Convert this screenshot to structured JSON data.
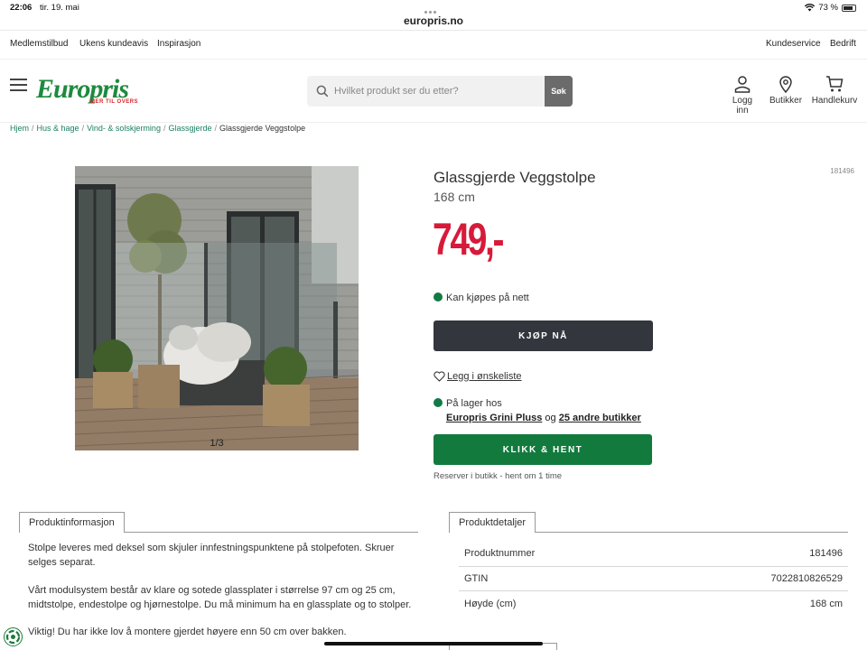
{
  "status_bar": {
    "time": "22:06",
    "date": "tir. 19. mai",
    "url": "europris.no",
    "battery": "73 %"
  },
  "top_nav": {
    "left": [
      "Medlemstilbud",
      "Ukens kundeavis",
      "Inspirasjon"
    ],
    "right": [
      "Kundeservice",
      "Bedrift"
    ]
  },
  "header": {
    "logo_text": "Europris",
    "logo_tagline": "MER TIL OVERS",
    "search_placeholder": "Hvilket produkt ser du etter?",
    "search_button": "Søk",
    "icons": [
      {
        "icon": "user-icon",
        "label": "Logg inn"
      },
      {
        "icon": "location-pin-icon",
        "label": "Butikker"
      },
      {
        "icon": "cart-icon",
        "label": "Handlekurv"
      }
    ]
  },
  "breadcrumb": [
    "Hjem",
    "Hus & hage",
    "Vind- & solskjerming",
    "Glassgjerde",
    "Glassgjerde Veggstolpe"
  ],
  "product": {
    "image_counter": "1/3",
    "title": "Glassgjerde Veggstolpe",
    "subtitle": "168 cm",
    "sku": "181496",
    "price": "749,-",
    "online_status": "Kan kjøpes på nett",
    "buy_button": "KJØP NÅ",
    "wishlist": "Legg i ønskeliste",
    "stock_label": "På lager hos",
    "stock_store": "Europris Grini Pluss",
    "stock_joiner": "og",
    "stock_others": "25 andre butikker",
    "pickup_button": "KLIKK & HENT",
    "reserve_note": "Reserver i butikk - hent om 1 time"
  },
  "colors": {
    "brand_green": "#1d8a3e",
    "price_red": "#d71a3a",
    "buy_dark": "#33373d",
    "pickup_green": "#137a3e"
  },
  "tabs": {
    "info": "Produktinformasjon",
    "details": "Produktdetaljer"
  },
  "description": {
    "p1": "Stolpe leveres med deksel som skjuler innfestningspunktene på stolpefoten. Skruer selges separat.",
    "p2": "Vårt modulsystem består av klare og sotede glassplater i størrelse 97 cm og 25 cm, midtstolpe, endestolpe og hjørnestolpe. Du må minimum ha en glassplate og to stolper.",
    "p3": "Viktig! Du har ikke lov å montere gjerdet høyere enn 50 cm over bakken."
  },
  "details": [
    {
      "label": "Produktnummer",
      "value": "181496"
    },
    {
      "label": "GTIN",
      "value": "7022810826529"
    },
    {
      "label": "Høyde (cm)",
      "value": "168 cm"
    }
  ]
}
